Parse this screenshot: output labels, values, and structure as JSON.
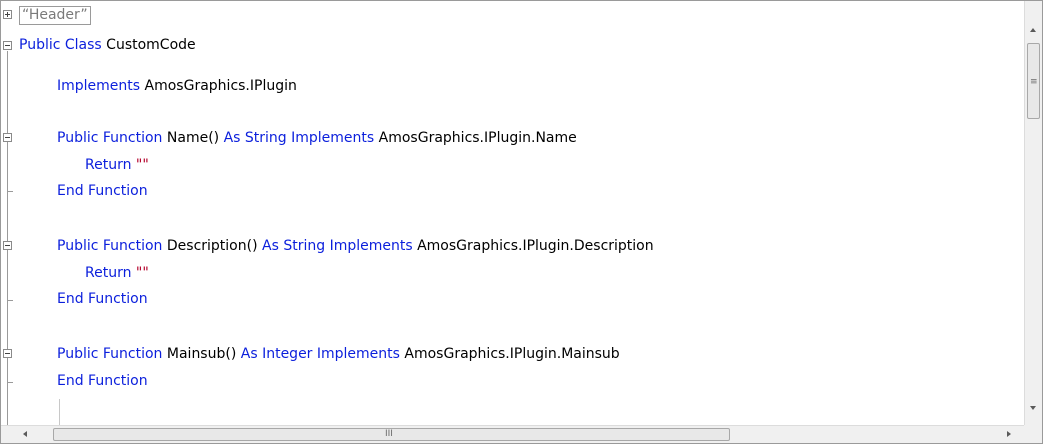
{
  "header_region": {
    "label": "Header"
  },
  "code": {
    "line1": {
      "kw1": "Public Class",
      "name": "CustomCode"
    },
    "line2": {
      "kw1": "Implements",
      "rest": "AmosGraphics.IPlugin"
    },
    "fn1": {
      "kw1": "Public Function",
      "name": "Name()",
      "kw2": "As String Implements",
      "rest": "AmosGraphics.IPlugin.Name",
      "return_kw": "Return",
      "return_val": "\"\"",
      "end": "End Function"
    },
    "fn2": {
      "kw1": "Public Function",
      "name": "Description()",
      "kw2": "As String Implements",
      "rest": "AmosGraphics.IPlugin.Description",
      "return_kw": "Return",
      "return_val": "\"\"",
      "end": "End Function"
    },
    "fn3": {
      "kw1": "Public Function",
      "name": "Mainsub()",
      "kw2": "As Integer Implements",
      "rest": "AmosGraphics.IPlugin.Mainsub",
      "end": "End Function"
    }
  },
  "scrollbars": {
    "hgrip": "III",
    "vgrip": "≡"
  },
  "colors": {
    "keyword": "#0b1fdc",
    "string": "#b3002a",
    "text": "#000000"
  }
}
